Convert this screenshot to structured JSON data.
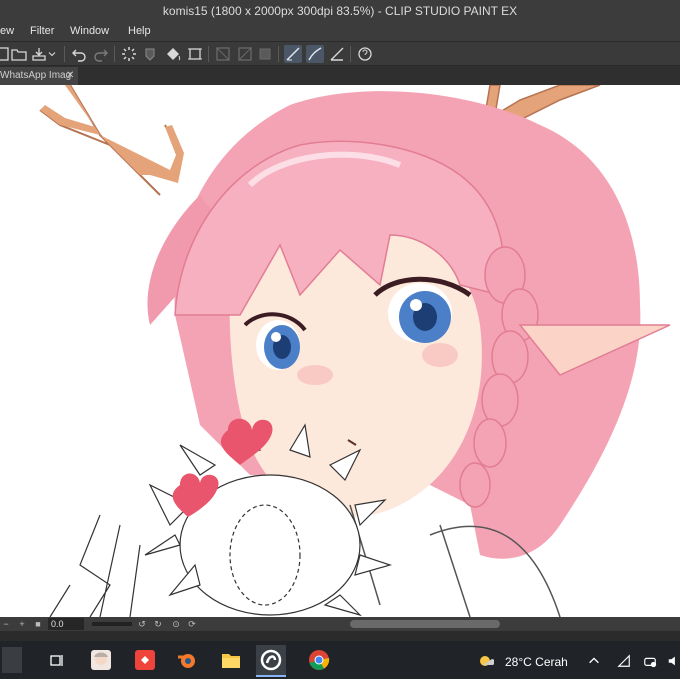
{
  "window": {
    "title": "komis15 (1800 x 2000px 300dpi 83.5%)  - CLIP STUDIO PAINT EX"
  },
  "menu": {
    "items": [
      "ew",
      "Filter",
      "Window",
      "Help"
    ]
  },
  "toolbar": {
    "icons": [
      "new-icon",
      "open-icon",
      "save-icon",
      "undo-icon",
      "redo-icon",
      "loading-icon",
      "fill-icon",
      "bucket-icon",
      "transform-icon",
      "selection-icon",
      "brush-icon",
      "pen-icon",
      "ruler-icon",
      "help-icon"
    ]
  },
  "tab": {
    "label": "WhatsApp Imag",
    "close": "✕"
  },
  "status": {
    "zoom": "0.0"
  },
  "taskbar": {
    "weather": "28°C  Cerah",
    "apps": [
      "taskview-icon",
      "anime-app-icon",
      "anydesk-icon",
      "blender-icon",
      "file-explorer-icon",
      "clip-studio-icon",
      "chrome-icon"
    ]
  },
  "colors": {
    "hair": "#f4a3b4",
    "hair_shadow": "#e27d93",
    "antler": "#e5a37a",
    "skin": "#fde8dc",
    "eye": "#4b7fc8",
    "heart": "#e9556d",
    "toolbar_bg": "#3a3a3a",
    "taskbar_bg": "#202328"
  }
}
